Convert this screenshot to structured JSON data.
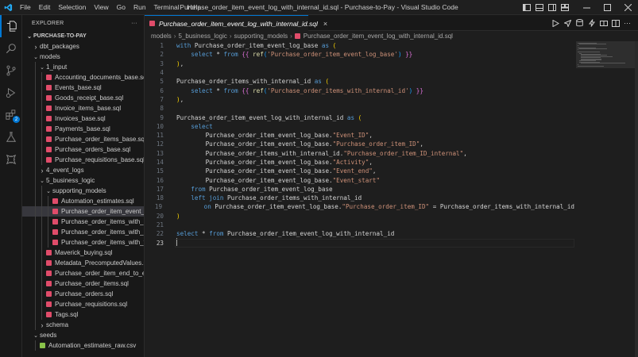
{
  "app": {
    "window_title": "Purchase_order_item_event_log_with_internal_id.sql - Purchase-to-Pay - Visual Studio Code",
    "menu": [
      "File",
      "Edit",
      "Selection",
      "View",
      "Go",
      "Run",
      "Terminal",
      "Help"
    ]
  },
  "activity_bar": {
    "items": [
      "explorer-icon",
      "search-icon",
      "source-control-icon",
      "run-debug-icon",
      "extensions-icon",
      "testing-icon",
      "dbt-icon"
    ],
    "extensions_badge": "2"
  },
  "sidebar": {
    "title": "EXPLORER",
    "more": "···",
    "tree": [
      {
        "label": "PURCHASE-TO-PAY",
        "depth": 0,
        "type": "root",
        "open": true
      },
      {
        "label": "dbt_packages",
        "depth": 1,
        "type": "folder",
        "open": false
      },
      {
        "label": "models",
        "depth": 1,
        "type": "folder",
        "open": true
      },
      {
        "label": "1_input",
        "depth": 2,
        "type": "folder",
        "open": true
      },
      {
        "label": "Accounting_documents_base.sql",
        "depth": 3,
        "type": "sql"
      },
      {
        "label": "Events_base.sql",
        "depth": 3,
        "type": "sql"
      },
      {
        "label": "Goods_receipt_base.sql",
        "depth": 3,
        "type": "sql"
      },
      {
        "label": "Invoice_items_base.sql",
        "depth": 3,
        "type": "sql"
      },
      {
        "label": "Invoices_base.sql",
        "depth": 3,
        "type": "sql"
      },
      {
        "label": "Payments_base.sql",
        "depth": 3,
        "type": "sql"
      },
      {
        "label": "Purchase_order_items_base.sql",
        "depth": 3,
        "type": "sql"
      },
      {
        "label": "Purchase_orders_base.sql",
        "depth": 3,
        "type": "sql"
      },
      {
        "label": "Purchase_requisitions_base.sql",
        "depth": 3,
        "type": "sql"
      },
      {
        "label": "4_event_logs",
        "depth": 2,
        "type": "folder",
        "open": false
      },
      {
        "label": "5_business_logic",
        "depth": 2,
        "type": "folder",
        "open": true
      },
      {
        "label": "supporting_models",
        "depth": 3,
        "type": "folder",
        "open": true
      },
      {
        "label": "Automation_estimates.sql",
        "depth": 4,
        "type": "sql"
      },
      {
        "label": "Purchase_order_item_event_log_...",
        "depth": 4,
        "type": "sql",
        "selected": true
      },
      {
        "label": "Purchase_order_items_with_inter...",
        "depth": 4,
        "type": "sql"
      },
      {
        "label": "Purchase_order_items_with_mav...",
        "depth": 4,
        "type": "sql"
      },
      {
        "label": "Purchase_order_items_with_thro...",
        "depth": 4,
        "type": "sql"
      },
      {
        "label": "Maverick_buying.sql",
        "depth": 3,
        "type": "sql"
      },
      {
        "label": "Metadata_PrecomputedValues.sql",
        "depth": 3,
        "type": "sql"
      },
      {
        "label": "Purchase_order_item_end_to_end_...",
        "depth": 3,
        "type": "sql"
      },
      {
        "label": "Purchase_order_items.sql",
        "depth": 3,
        "type": "sql"
      },
      {
        "label": "Purchase_orders.sql",
        "depth": 3,
        "type": "sql"
      },
      {
        "label": "Purchase_requisitions.sql",
        "depth": 3,
        "type": "sql"
      },
      {
        "label": "Tags.sql",
        "depth": 3,
        "type": "sql"
      },
      {
        "label": "schema",
        "depth": 2,
        "type": "folder",
        "open": false
      },
      {
        "label": "seeds",
        "depth": 1,
        "type": "folder",
        "open": true
      },
      {
        "label": "Automation_estimates_raw.csv",
        "depth": 2,
        "type": "csv"
      }
    ]
  },
  "tab": {
    "label": "Purchase_order_item_event_log_with_internal_id.sql",
    "close": "×"
  },
  "breadcrumb": [
    "models",
    "5_business_logic",
    "supporting_models",
    "Purchase_order_item_event_log_with_internal_id.sql"
  ],
  "editor": {
    "current_line": 23,
    "lines": [
      [
        [
          "k",
          "with "
        ],
        [
          "t",
          "Purchase_order_item_event_log_base "
        ],
        [
          "k",
          "as "
        ],
        [
          "b1",
          "("
        ]
      ],
      [
        [
          "t",
          "    "
        ],
        [
          "k",
          "select "
        ],
        [
          "t",
          "* "
        ],
        [
          "k",
          "from "
        ],
        [
          "b2",
          "{{ "
        ],
        [
          "f",
          "ref"
        ],
        [
          "b3",
          "("
        ],
        [
          "s",
          "'Purchase_order_item_event_log_base'"
        ],
        [
          "b3",
          ")"
        ],
        [
          "b2",
          " }}"
        ]
      ],
      [
        [
          "b1",
          ")"
        ],
        [
          "t",
          ","
        ]
      ],
      [],
      [
        [
          "t",
          "Purchase_order_items_with_internal_id "
        ],
        [
          "k",
          "as "
        ],
        [
          "b1",
          "("
        ]
      ],
      [
        [
          "t",
          "    "
        ],
        [
          "k",
          "select "
        ],
        [
          "t",
          "* "
        ],
        [
          "k",
          "from "
        ],
        [
          "b2",
          "{{ "
        ],
        [
          "f",
          "ref"
        ],
        [
          "b3",
          "("
        ],
        [
          "s",
          "'Purchase_order_items_with_internal_id'"
        ],
        [
          "b3",
          ")"
        ],
        [
          "b2",
          " }}"
        ]
      ],
      [
        [
          "b1",
          ")"
        ],
        [
          "t",
          ","
        ]
      ],
      [],
      [
        [
          "t",
          "Purchase_order_item_event_log_with_internal_id "
        ],
        [
          "k",
          "as "
        ],
        [
          "b1",
          "("
        ]
      ],
      [
        [
          "t",
          "    "
        ],
        [
          "k",
          "select"
        ]
      ],
      [
        [
          "t",
          "        Purchase_order_item_event_log_base."
        ],
        [
          "s",
          "\"Event_ID\""
        ],
        [
          "t",
          ","
        ]
      ],
      [
        [
          "t",
          "        Purchase_order_item_event_log_base."
        ],
        [
          "s",
          "\"Purchase_order_item_ID\""
        ],
        [
          "t",
          ","
        ]
      ],
      [
        [
          "t",
          "        Purchase_order_items_with_internal_id."
        ],
        [
          "s",
          "\"Purchase_order_item_ID_internal\""
        ],
        [
          "t",
          ","
        ]
      ],
      [
        [
          "t",
          "        Purchase_order_item_event_log_base."
        ],
        [
          "s",
          "\"Activity\""
        ],
        [
          "t",
          ","
        ]
      ],
      [
        [
          "t",
          "        Purchase_order_item_event_log_base."
        ],
        [
          "s",
          "\"Event_end\""
        ],
        [
          "t",
          ","
        ]
      ],
      [
        [
          "t",
          "        Purchase_order_item_event_log_base."
        ],
        [
          "s",
          "\"Event_start\""
        ]
      ],
      [
        [
          "t",
          "    "
        ],
        [
          "k",
          "from "
        ],
        [
          "t",
          "Purchase_order_item_event_log_base"
        ]
      ],
      [
        [
          "t",
          "    "
        ],
        [
          "k",
          "left join "
        ],
        [
          "t",
          "Purchase_order_items_with_internal_id"
        ]
      ],
      [
        [
          "t",
          "        "
        ],
        [
          "k",
          "on "
        ],
        [
          "t",
          "Purchase_order_item_event_log_base."
        ],
        [
          "s",
          "\"Purchase_order_item_ID\""
        ],
        [
          "t",
          " = Purchase_order_items_with_internal_id"
        ]
      ],
      [
        [
          "b1",
          ")"
        ]
      ],
      [],
      [
        [
          "k",
          "select "
        ],
        [
          "t",
          "* "
        ],
        [
          "k",
          "from "
        ],
        [
          "t",
          "Purchase_order_item_event_log_with_internal_id"
        ]
      ],
      []
    ]
  },
  "colors": {
    "accent": "#0078d4",
    "sql_icon": "#e04c6a",
    "csv_icon": "#89c24a",
    "keyword": "#569cd6",
    "string": "#ce9178",
    "function": "#dcdcaa"
  }
}
